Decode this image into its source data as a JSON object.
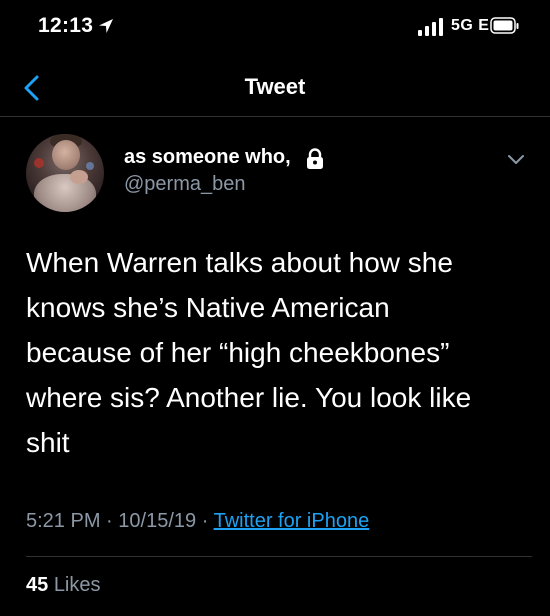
{
  "status_bar": {
    "time": "12:13",
    "network": "5G E",
    "icons": [
      "location-arrow-icon",
      "cellular-signal-icon",
      "battery-icon"
    ]
  },
  "nav": {
    "title": "Tweet",
    "back_icon": "chevron-left-icon"
  },
  "tweet": {
    "author": {
      "display_name": "as someone who,",
      "handle": "@perma_ben",
      "protected_icon": "lock-icon"
    },
    "menu_icon": "chevron-down-icon",
    "text_lines": [
      "When Warren talks about how she",
      "knows she’s Native American",
      "because of her “high cheekbones”",
      "where sis? Another lie. You look like",
      "shit"
    ],
    "time": "5:21 PM",
    "date": "10/15/19",
    "separator": "·",
    "source": "Twitter for iPhone",
    "likes_count": "45",
    "likes_label": "Likes"
  },
  "colors": {
    "background": "#000000",
    "text": "#ffffff",
    "secondary_text": "#8b98a5",
    "link": "#1da1f2",
    "divider": "#2f3336"
  }
}
